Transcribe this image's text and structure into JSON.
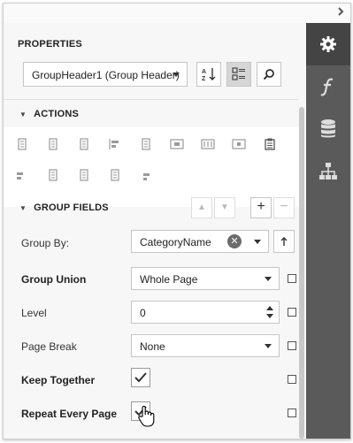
{
  "panel": {
    "title": "PROPERTIES",
    "selected_object": "GroupHeader1 (Group Header)"
  },
  "toolbar": {
    "sort_alpha_icon": "sort-alphabetical-icon",
    "categorized_icon": "categorized-view-icon",
    "search_icon": "search-icon"
  },
  "side_tabs": [
    {
      "name": "properties-tab",
      "icon": "gear-icon",
      "active": true
    },
    {
      "name": "expressions-tab",
      "icon": "function-icon",
      "active": false
    },
    {
      "name": "data-source-tab",
      "icon": "database-icon",
      "active": false
    },
    {
      "name": "report-explorer-tab",
      "icon": "hierarchy-icon",
      "active": false
    }
  ],
  "actions": {
    "header": "ACTIONS",
    "row1": [
      "align-left-icon",
      "align-center-icon",
      "align-right-icon",
      "align-to-grid-icon",
      "size-to-grid-icon",
      "center-horizontally-icon",
      "center-vertically-icon",
      "horizontal-spacing-icon",
      "paste-icon"
    ],
    "row2": [
      "align-top-icon",
      "align-middle-icon",
      "align-bottom-icon",
      "same-size-icon",
      "vertical-spacing-icon"
    ]
  },
  "group_fields": {
    "header": "GROUP FIELDS",
    "group_by_label": "Group By:",
    "group_by_value": "CategoryName"
  },
  "properties": {
    "group_union_label": "Group Union",
    "group_union_value": "Whole Page",
    "level_label": "Level",
    "level_value": "0",
    "page_break_label": "Page Break",
    "page_break_value": "None",
    "keep_together_label": "Keep Together",
    "keep_together_checked": true,
    "repeat_every_page_label": "Repeat Every Page",
    "repeat_every_page_checked": true
  },
  "colors": {
    "tab_bar": "#5a5a5a",
    "active_tab": "#444444",
    "panel_bg": "#f7f7f7"
  }
}
